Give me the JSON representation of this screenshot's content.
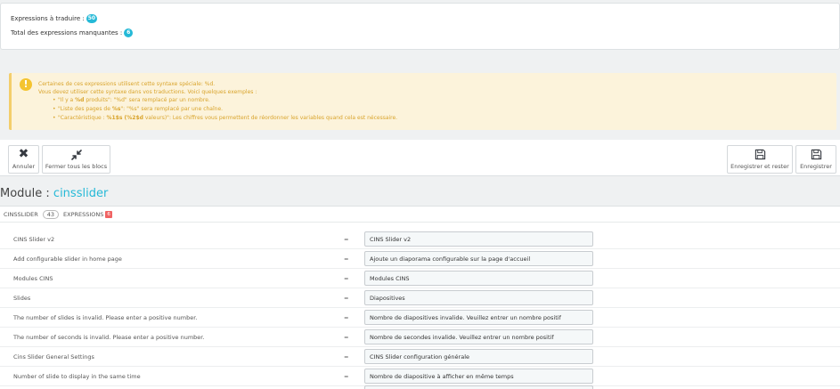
{
  "stats": {
    "to_translate_label": "Expressions à traduire :",
    "to_translate_count": "50",
    "missing_label": "Total des expressions manquantes :",
    "missing_count": "6"
  },
  "warning": {
    "line1": "Certaines de ces expressions utilisent cette syntaxe spéciale: %d.",
    "line2": "Vous devez utiliser cette syntaxe dans vos traductions. Voici quelques exemples :",
    "examples": [
      {
        "pre": "\"Il y a ",
        "bold": "%d",
        "post": " produits\": \"%d\" sera remplacé par un nombre."
      },
      {
        "pre": "\"Liste des pages de ",
        "bold": "%s",
        "post": "\": \"%s\" sera remplacé par une chaîne."
      },
      {
        "pre": "\"Caractéristique : ",
        "bold": "%1$s (%2$d",
        "post": " valeurs)\": Les chiffres vous permettent de réordonner les variables quand cela est nécessaire."
      }
    ]
  },
  "toolbar": {
    "cancel_label": "Annuler",
    "collapse_label": "Fermer tous les blocs",
    "save_stay_label": "Enregistrer et rester",
    "save_label": "Enregistrer"
  },
  "module": {
    "prefix": "Module : ",
    "name": "cinsslider",
    "tab_label": "CINSSLIDER",
    "tab_count": "43",
    "expressions_label": "EXPRESSIONS",
    "missing_count": "6"
  },
  "rows": [
    {
      "source": "CINS Slider v2",
      "eq": "=",
      "translation": "CINS Slider v2"
    },
    {
      "source": "Add configurable slider in home page",
      "eq": "=",
      "translation": "Ajoute un diaporama configurable sur la page d'accueil"
    },
    {
      "source": "Modules CINS",
      "eq": "=",
      "translation": "Modules CINS"
    },
    {
      "source": "Slides",
      "eq": "=",
      "translation": "Diapositives"
    },
    {
      "source": "The number of slides is invalid. Please enter a positive number.",
      "eq": "=",
      "translation": "Nombre de diapositives invalide. Veuillez entrer un nombre positif"
    },
    {
      "source": "The number of seconds is invalid. Please enter a positive number.",
      "eq": "=",
      "translation": "Nombre de secondes invalide. Veuillez entrer un nombre positif"
    },
    {
      "source": "Cins Slider General Settings",
      "eq": "=",
      "translation": "CINS Slider configuration générale"
    },
    {
      "source": "Number of slide to display in the same time",
      "eq": "=",
      "translation": "Nombre de diapositive à afficher en même temps"
    }
  ],
  "colors": {
    "accent": "#25b9d7",
    "warning_bg": "#fcf3db",
    "warning_text": "#d9a42c",
    "danger": "#f06363"
  }
}
